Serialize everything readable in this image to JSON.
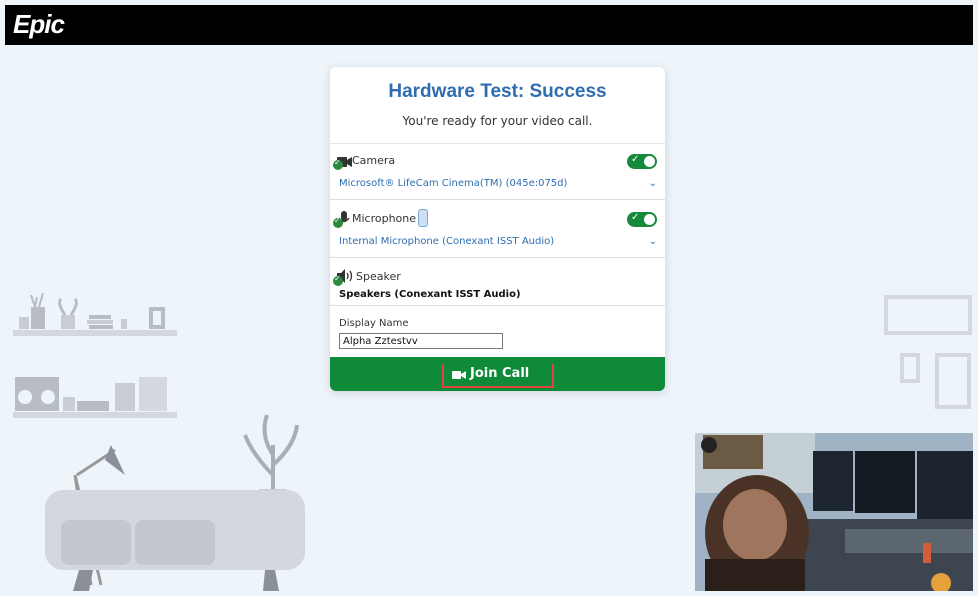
{
  "app": {
    "logo": "Epic"
  },
  "card": {
    "title": "Hardware Test: Success",
    "subtitle": "You're ready for your video call.",
    "camera": {
      "label": "Camera",
      "device": "Microsoft® LifeCam Cinema(TM) (045e:075d)",
      "enabled": true,
      "icon": "camera-icon"
    },
    "microphone": {
      "label": "Microphone",
      "device": "Internal Microphone (Conexant ISST Audio)",
      "enabled": true,
      "icon": "microphone-icon"
    },
    "speaker": {
      "label": "Speaker",
      "device": "Speakers (Conexant ISST Audio)",
      "icon": "speaker-icon"
    },
    "display_name": {
      "label": "Display Name",
      "value": "Alpha Zztestvv"
    },
    "join": {
      "label": "Join Call",
      "icon": "video-camera-icon"
    }
  },
  "colors": {
    "accent": "#2f6db1",
    "success": "#0f8a38",
    "highlight": "#e2453f",
    "topbar": "#000000"
  }
}
